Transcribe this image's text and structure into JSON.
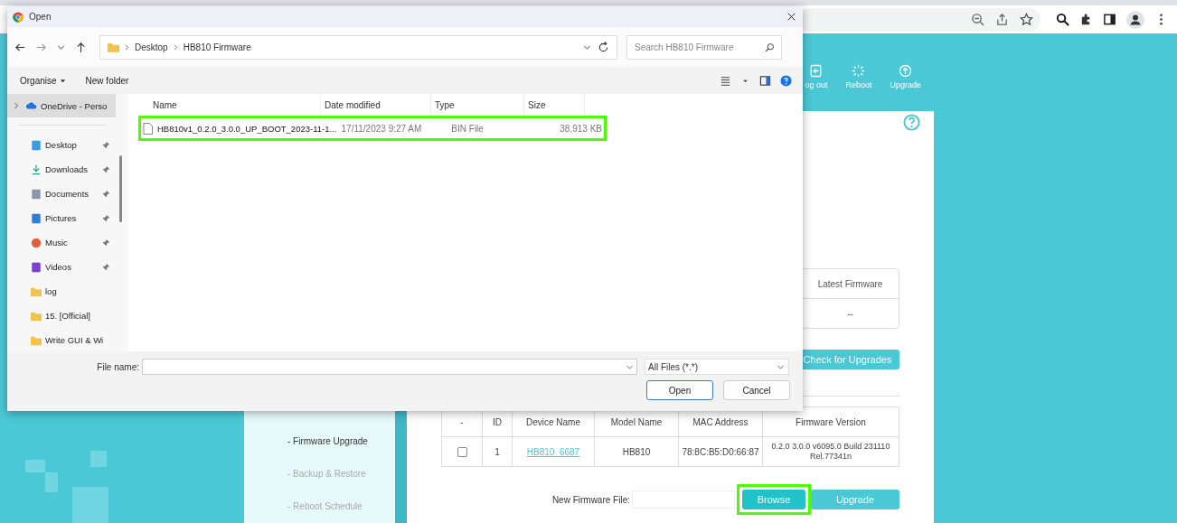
{
  "app": {
    "nav": [
      {
        "kind": "logout",
        "label": "og out"
      },
      {
        "kind": "reboot",
        "label": "Reboot"
      },
      {
        "kind": "upgrade",
        "label": "Upgrade"
      }
    ],
    "sidebar": {
      "items": [
        {
          "label": "- Firmware Upgrade",
          "selected": true
        },
        {
          "label": "- Backup & Restore",
          "selected": false
        },
        {
          "label": "- Reboot Schedule",
          "selected": false
        }
      ]
    },
    "firmware_table": {
      "columns": [
        "Latest Firmware"
      ],
      "rows": [
        [
          "--"
        ]
      ]
    },
    "check_button": "Check for Upgrades",
    "device_table": {
      "columns": [
        "-",
        "ID",
        "Device Name",
        "Model Name",
        "MAC Address",
        "Firmware Version"
      ],
      "rows": [
        {
          "checked": false,
          "id": "1",
          "device_name": "HB810_6687",
          "model_name": "HB810",
          "mac": "78:8C:B5:D0:66:87",
          "firmware": "0.2.0 3.0.0 v6095.0 Build 231110 Rel.77341n"
        }
      ]
    },
    "upload": {
      "label": "New Firmware File:",
      "browse": "Browse",
      "upgrade": "Upgrade",
      "browse_highlighted": true
    }
  },
  "dialog": {
    "title": "Open",
    "path": [
      "Desktop",
      "HB810 Firmware"
    ],
    "search": {
      "placeholder": "Search HB810 Firmware"
    },
    "toolbar": {
      "organise": "Organise",
      "new_folder": "New folder"
    },
    "nav_items": [
      {
        "kind": "onedrive",
        "label": "OneDrive - Perso",
        "selected": true,
        "pinned": false
      },
      {
        "kind": "desktop",
        "label": "Desktop",
        "selected": false,
        "pinned": true
      },
      {
        "kind": "downloads",
        "label": "Downloads",
        "selected": false,
        "pinned": true
      },
      {
        "kind": "documents",
        "label": "Documents",
        "selected": false,
        "pinned": true
      },
      {
        "kind": "pictures",
        "label": "Pictures",
        "selected": false,
        "pinned": true
      },
      {
        "kind": "music",
        "label": "Music",
        "selected": false,
        "pinned": true
      },
      {
        "kind": "videos",
        "label": "Videos",
        "selected": false,
        "pinned": true
      },
      {
        "kind": "folder",
        "label": "log",
        "selected": false,
        "pinned": false
      },
      {
        "kind": "folder",
        "label": "15. [Official]",
        "selected": false,
        "pinned": false
      },
      {
        "kind": "folder",
        "label": "Write GUI & Wi",
        "selected": false,
        "pinned": false
      }
    ],
    "columns": [
      "Name",
      "Date modified",
      "Type",
      "Size"
    ],
    "files": [
      {
        "name": "HB810v1_0.2.0_3.0.0_UP_BOOT_2023-11-1...",
        "date": "17/11/2023 9:27 AM",
        "type": "BIN File",
        "size": "38,913 KB",
        "highlighted": true
      }
    ],
    "file_name_label": "File name:",
    "file_type": "All Files (*.*)",
    "open": "Open",
    "cancel": "Cancel"
  }
}
